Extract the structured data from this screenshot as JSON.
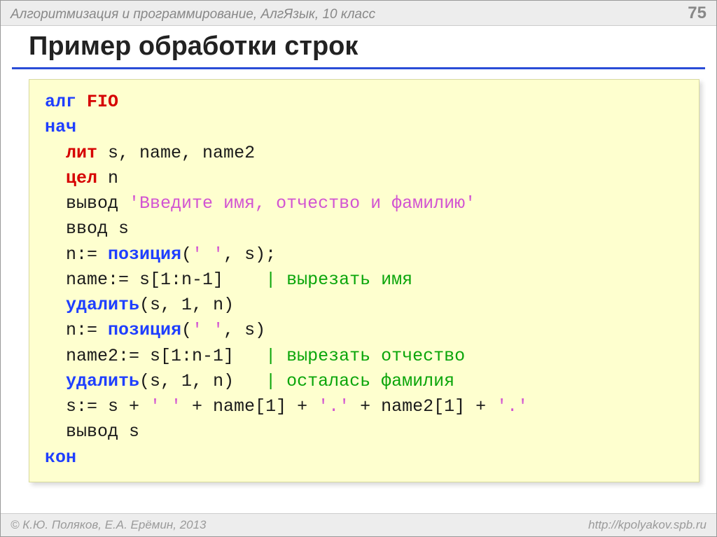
{
  "header": {
    "subject": "Алгоритмизация и программирование, АлгЯзык, 10 класс",
    "page": "75"
  },
  "title": "Пример обработки строк",
  "code": {
    "l1_kw": "алг",
    "l1_name": " FIO",
    "l2": "нач",
    "l3_kw": "лит",
    "l3_rest": " s, name, name2",
    "l4_kw": "цел",
    "l4_rest": " n",
    "l5a": "  вывод ",
    "l5b": "'Введите имя, отчество и фамилию'",
    "l6": "  ввод s",
    "l7a": "  n:= ",
    "l7b": "позиция",
    "l7c": "(",
    "l7d": "' '",
    "l7e": ", s);",
    "l8a": "  name:= s[1:n-1]    ",
    "l8b": "| вырезать имя",
    "l9a": "  ",
    "l9b": "удалить",
    "l9c": "(s, 1, n)",
    "l10a": "  n:= ",
    "l10b": "позиция",
    "l10c": "(",
    "l10d": "' '",
    "l10e": ", s)",
    "l11a": "  name2:= s[1:n-1]   ",
    "l11b": "| вырезать отчество",
    "l12a": "  ",
    "l12b": "удалить",
    "l12c": "(s, 1, n)   ",
    "l12d": "| осталась фамилия",
    "l13a": "  s:= s + ",
    "l13b": "' '",
    "l13c": " + name[1] + ",
    "l13d": "'.'",
    "l13e": " + name2[1] + ",
    "l13f": "'.'",
    "l14": "  вывод s",
    "l15": "кон"
  },
  "footer": {
    "left": "© К.Ю. Поляков, Е.А. Ерёмин, 2013",
    "right": "http://kpolyakov.spb.ru"
  }
}
